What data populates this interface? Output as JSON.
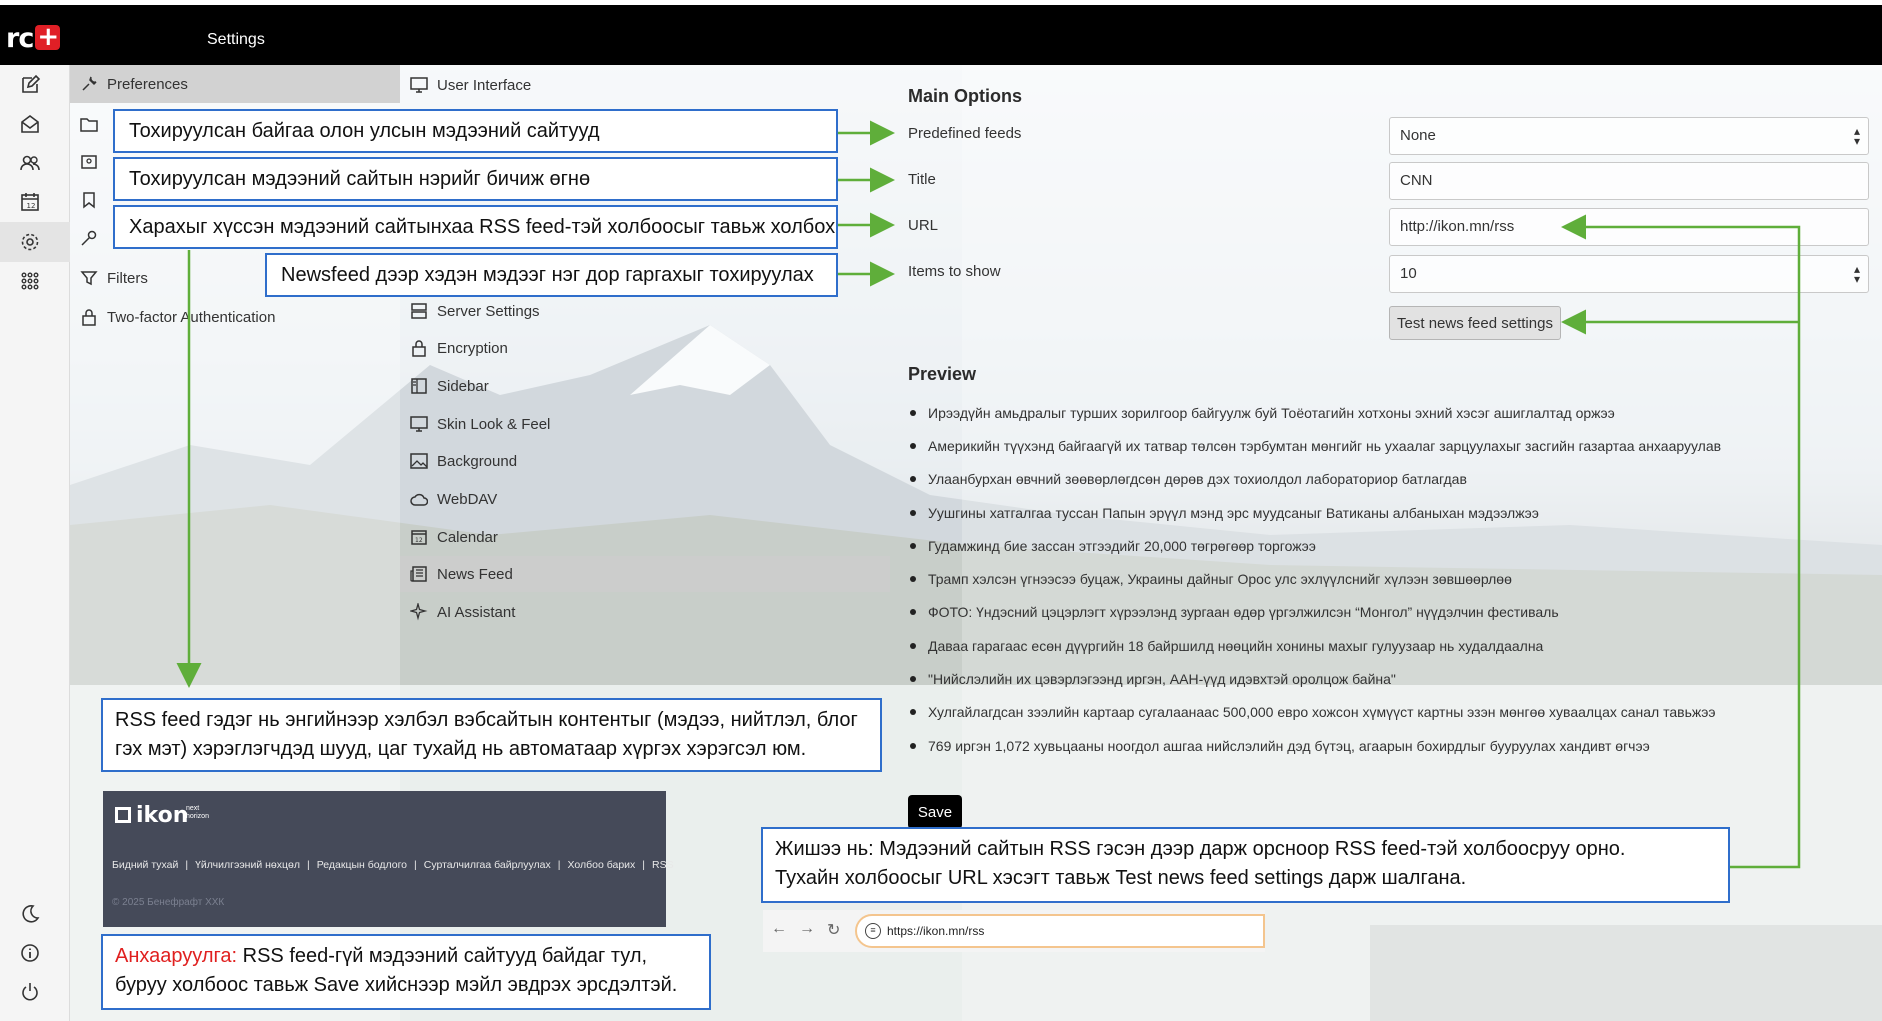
{
  "app": {
    "logo_text": "rc",
    "title": "Settings"
  },
  "preferences": {
    "header": "Preferences",
    "items": [
      {
        "label": "Filters",
        "icon": "filter-icon"
      },
      {
        "label": "Two-factor Authentication",
        "icon": "lock-icon"
      }
    ]
  },
  "sections": {
    "first": "User Interface",
    "items": [
      {
        "label": "Server Settings",
        "icon": "server-icon"
      },
      {
        "label": "Encryption",
        "icon": "lock-icon"
      },
      {
        "label": "Sidebar",
        "icon": "sidebar-icon"
      },
      {
        "label": "Skin Look & Feel",
        "icon": "monitor-icon"
      },
      {
        "label": "Background",
        "icon": "image-icon"
      },
      {
        "label": "WebDAV",
        "icon": "cloud-icon"
      },
      {
        "label": "Calendar",
        "icon": "calendar-icon"
      },
      {
        "label": "News Feed",
        "icon": "newspaper-icon",
        "active": true
      },
      {
        "label": "AI Assistant",
        "icon": "sparkle-icon"
      }
    ]
  },
  "main_options": {
    "title": "Main Options",
    "predefined_label": "Predefined feeds",
    "predefined_value": "None",
    "title_label": "Title",
    "title_value": "CNN",
    "url_label": "URL",
    "url_value": "http://ikon.mn/rss",
    "items_label": "Items to show",
    "items_value": "10",
    "test_button": "Test news feed settings"
  },
  "preview": {
    "title": "Preview",
    "items": [
      "Ирээдүйн амьдралыг турших зорилгоор байгуулж буй Тоёотагийн хотхоны эхний хэсэг ашиглалтад оржээ",
      "Америкийн түүхэнд байгаагүй их татвар төлсөн тэрбумтан мөнгийг нь ухаалаг зарцуулахыг засгийн газартаа анхааруулав",
      "Улаанбурхан өвчний зөөвөрлөгдсөн дөрөв дэх тохиолдол лабораториор батлагдав",
      "Уушгины хатгалгаа туссан Папын эрүүл мэнд эрс муудсаныг Ватиканы албаныхан мэдээлжээ",
      "Гудамжинд бие зассан этгээдийг 20,000 төгрөгөөр торгожээ",
      "Трамп хэлсэн үгнээсээ буцаж, Украины дайныг Орос улс эхлүүлснийг хүлээн зөвшөөрлөө",
      "ФОТО: Үндэсний цэцэрлэгт хүрээлэнд зургаан өдөр үргэлжилсэн “Монгол” нүүдэлчин фестиваль",
      "Даваа гарагаас есөн дүүргийн 18 байршилд нөөцийн хонины махыг гулуузаар нь худалдаална",
      "\"Нийслэлийн их цэвэрлэгээнд иргэн, ААН-үүд идэвхтэй оролцож байна\"",
      "Хулгайлагдсан зээлийн картаар сугалаанаас 500,000 евро хожсон хүмүүст картны эзэн мөнгөө хуваалцах санал тавьжээ",
      "769 иргэн 1,072 хувьцааны ноогдол ашгаа нийслэлийн дэд бүтэц, агаарын бохирдлыг бууруулах хандивт өгчээ"
    ]
  },
  "save_button": "Save",
  "callouts": {
    "c1": "Тохируулсан байгаа олон улсын мэдээний сайтууд",
    "c2": "Тохируулсан мэдээний сайтын нэрийг бичиж өгнө",
    "c3": "Харахыг хүссэн мэдээний сайтынхаа RSS feed-тэй холбоосыг тавьж холбох",
    "c4": "Newsfeed дээр хэдэн мэдээг нэг дор гаргахыг тохируулах",
    "rss_line1": "RSS feed гэдэг нь энгийнээр хэлбэл вэбсайтын контентыг (мэдээ, нийтлэл, блог",
    "rss_line2": "гэх мэт) хэрэглэгчдэд шууд, цаг тухайд нь автоматаар хүргэх хэрэгсэл юм.",
    "example_line1": "Жишээ нь: Мэдээний сайтын RSS гэсэн дээр дарж орсноор  RSS feed-тэй холбоосруу орно.",
    "example_line2": "Тухайн холбоосыг URL хэсэгт тавьж Test news feed settings дарж шалгана.",
    "warn_prefix": "Анхааруулга:",
    "warn_line1": " RSS feed-гүй мэдээний сайтууд байдаг тул,",
    "warn_line2": "буруу холбоос тавьж Save хийснээр мэйл эвдрэх эрсдэлтэй."
  },
  "ikon_footer": {
    "logo": "ikon",
    "tag_line1": "next",
    "tag_line2": "horizon",
    "nav": [
      "Бидний тухай",
      "Үйлчилгээний нөхцөл",
      "Редакцын бодлого",
      "Сурталчилгаа байрлуулах",
      "Холбоо барих",
      "RSS"
    ],
    "copyright": "© 2025 Бенефрафт ХХК"
  },
  "browser_example": {
    "url": "https://ikon.mn/rss"
  },
  "colors": {
    "callout_border": "#2f6ecb",
    "arrow": "#5fae3a",
    "warning": "#e0201f",
    "topbar": "#000000"
  }
}
